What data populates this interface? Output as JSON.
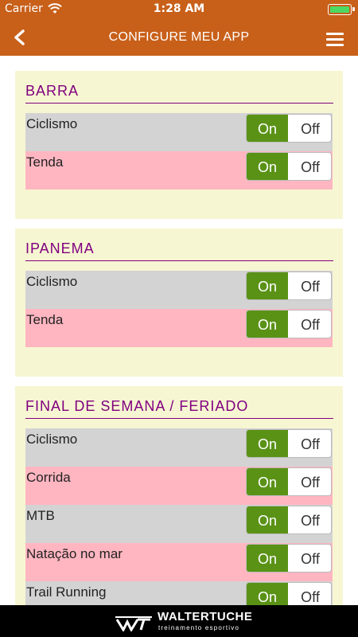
{
  "status": {
    "carrier": "Carrier",
    "time": "1:28 AM"
  },
  "nav": {
    "title": "CONFIGURE MEU APP"
  },
  "sections": [
    {
      "title": "BARRA",
      "items": [
        {
          "label": "Ciclismo",
          "on": "On",
          "off": "Off"
        },
        {
          "label": "Tenda",
          "on": "On",
          "off": "Off"
        }
      ]
    },
    {
      "title": "IPANEMA",
      "items": [
        {
          "label": "Ciclismo",
          "on": "On",
          "off": "Off"
        },
        {
          "label": "Tenda",
          "on": "On",
          "off": "Off"
        }
      ]
    },
    {
      "title": "FINAL DE SEMANA / FERIADO",
      "items": [
        {
          "label": "Ciclismo",
          "on": "On",
          "off": "Off"
        },
        {
          "label": "Corrida",
          "on": "On",
          "off": "Off"
        },
        {
          "label": "MTB",
          "on": "On",
          "off": "Off"
        },
        {
          "label": "Natação no mar",
          "on": "On",
          "off": "Off"
        },
        {
          "label": "Trail Running",
          "on": "On",
          "off": "Off"
        }
      ]
    }
  ],
  "footer": {
    "brand": "WALTERTUCHE",
    "tagline": "treinamento esportivo"
  },
  "colors": {
    "accent": "#c8601a",
    "section_title": "#800080",
    "toggle_on": "#5a9216",
    "row_gray": "#d3d3d3",
    "row_pink": "#ffb6c1",
    "section_bg": "#f7f6d2"
  }
}
